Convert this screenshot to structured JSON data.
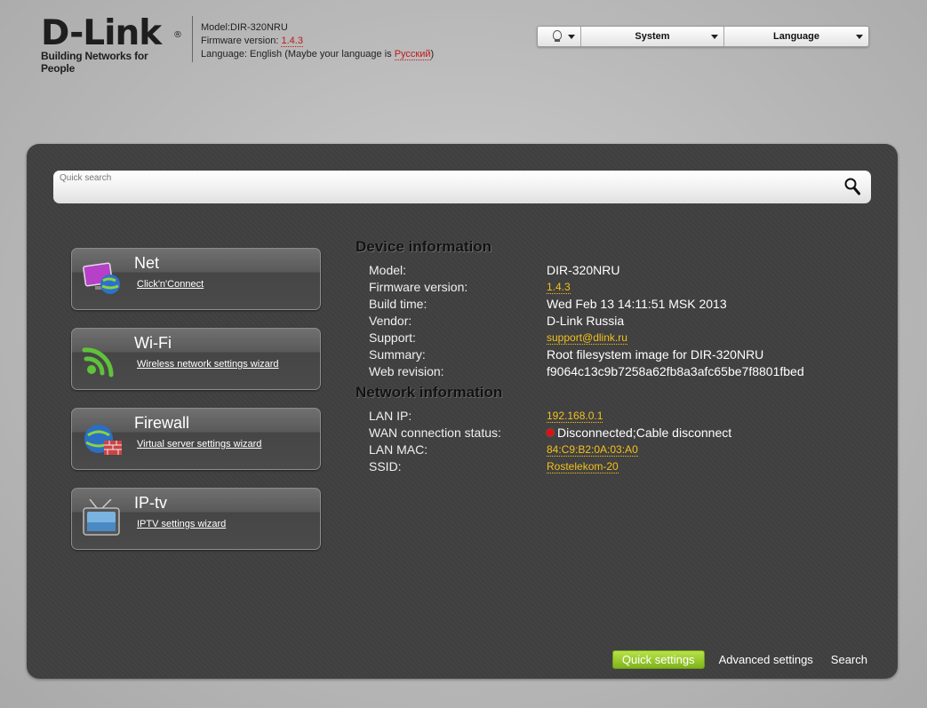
{
  "header": {
    "logo_text": "D-Link",
    "logo_reg": "®",
    "tagline": "Building Networks for People",
    "model_line": "Model:DIR-320NRU",
    "firmware_label": "Firmware version: ",
    "firmware_value": "1.4.3",
    "language_label": "Language: English (Maybe your language is ",
    "language_link": "Русский",
    "language_end": ")"
  },
  "topbar": {
    "system_label": "System",
    "language_label": "Language",
    "bulb_icon": "lightbulb-icon"
  },
  "search": {
    "placeholder": "Quick search",
    "icon": "magnifier-icon"
  },
  "tiles": [
    {
      "title": "Net",
      "link": "Click'n'Connect",
      "icon": "monitor-globe-icon"
    },
    {
      "title": "Wi-Fi",
      "link": "Wireless network settings wizard",
      "icon": "wifi-icon"
    },
    {
      "title": "Firewall",
      "link": "Virtual server settings wizard",
      "icon": "globe-brickwall-icon"
    },
    {
      "title": "IP-tv",
      "link": "IPTV settings wizard",
      "icon": "tv-icon"
    }
  ],
  "device": {
    "title": "Device information",
    "rows": [
      {
        "k": "Model:",
        "v": "DIR-320NRU"
      },
      {
        "k": "Firmware version:",
        "v": "1.4.3"
      },
      {
        "k": "Build time:",
        "v": "Wed Feb 13 14:11:51 MSK 2013"
      },
      {
        "k": "Vendor:",
        "v": "D-Link Russia"
      },
      {
        "k": "Support:",
        "v": "support@dlink.ru"
      },
      {
        "k": "Summary:",
        "v": "Root filesystem image for DIR-320NRU"
      },
      {
        "k": "Web revision:",
        "v": "f9064c13c9b7258a62fb8a3afc65be7f8801fbed"
      }
    ]
  },
  "network": {
    "title": "Network information",
    "rows": [
      {
        "k": "LAN IP:",
        "v": "192.168.0.1"
      },
      {
        "k": "WAN connection status:",
        "v": "Disconnected;Cable disconnect"
      },
      {
        "k": "LAN MAC:",
        "v": "84:C9:B2:0A:03:A0"
      },
      {
        "k": "SSID:",
        "v": "Rostelekom-20"
      }
    ]
  },
  "bottom_nav": {
    "quick": "Quick settings",
    "advanced": "Advanced settings",
    "search": "Search"
  },
  "colors": {
    "accent_link": "#f4c01c",
    "status_red": "#e01010",
    "quick_green": "#8dc11f"
  }
}
